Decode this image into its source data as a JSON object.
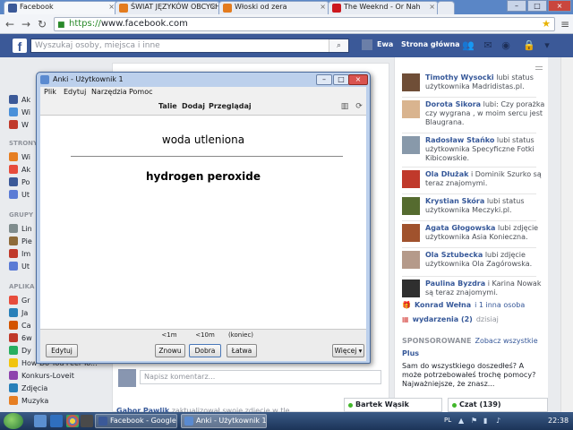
{
  "browser": {
    "tabs": [
      {
        "title": "Facebook",
        "color": "#3b5998"
      },
      {
        "title": "ŚWIAT JĘZYKÓW OBCYCH",
        "color": "#e37b1e"
      },
      {
        "title": "Włoski od zera",
        "color": "#e37b1e"
      },
      {
        "title": "The Weeknd - Or Nah",
        "color": "#cc181e"
      }
    ],
    "url_scheme": "https://",
    "url_host": "www.facebook.com"
  },
  "facebook": {
    "search_placeholder": "Wyszukaj osoby, miejsca i inne",
    "user_name": "Ewa",
    "home_link": "Strona główna",
    "left": {
      "head_pages": "STRONY",
      "head_groups": "GRUPY",
      "head_apps": "APLIKA",
      "items": [
        {
          "label": "Ak",
          "color": "#3b5998"
        },
        {
          "label": "Wi",
          "color": "#4a90d9"
        },
        {
          "label": "W",
          "color": "#c0392b"
        },
        {
          "label": "Wi",
          "color": "#e67e22"
        },
        {
          "label": "Ak",
          "color": "#e74c3c"
        },
        {
          "label": "Po",
          "color": "#3b5998"
        },
        {
          "label": "Ut",
          "color": "#5b7bd5"
        },
        {
          "label": "Lin",
          "color": "#7f8c8d"
        },
        {
          "label": "Pie",
          "color": "#8e6b3a"
        },
        {
          "label": "Im",
          "color": "#c0392b"
        },
        {
          "label": "Ut",
          "color": "#5b7bd5"
        },
        {
          "label": "Gr",
          "color": "#e74c3c"
        },
        {
          "label": "Ja",
          "color": "#2980b9"
        },
        {
          "label": "Ca",
          "color": "#d35400"
        },
        {
          "label": "6w",
          "color": "#c0392b"
        },
        {
          "label": "Dy",
          "color": "#27ae60"
        },
        {
          "label": "How Do You Feel To...",
          "color": "#f1c40f"
        },
        {
          "label": "Konkurs-Loveit",
          "color": "#8e44ad"
        },
        {
          "label": "Zdjęcia",
          "color": "#2980b9"
        },
        {
          "label": "Muzyka",
          "color": "#e67e22"
        }
      ]
    },
    "comment_placeholder": "Napisz komentarz...",
    "feed_bottom_who": "Gabor Pawlik",
    "feed_bottom_text": "zaktualizował swoje zdjęcie w tle",
    "ticker": [
      {
        "name": "Timothy Wysocki",
        "text": "lubi status użytkownika Madridistas.pl.",
        "color": "#6f4e37"
      },
      {
        "name": "Dorota Sikora",
        "text": "lubi: Czy porażka czy wygrana , w moim sercu jest Blaugrana.",
        "color": "#d9b48f"
      },
      {
        "name": "Radosław Stańko",
        "text": "lubi status użytkownika Specyficzne Fotki Kibicowskie.",
        "color": "#8899aa"
      },
      {
        "name": "Ola Dłużak",
        "text": "i Dominik Szurko są teraz znajomymi.",
        "color": "#c0392b"
      },
      {
        "name": "Krystian Skóra",
        "text": "lubi status użytkownika Meczyki.pl.",
        "color": "#556b2f"
      },
      {
        "name": "Agata Głogowska",
        "text": "lubi zdjęcie użytkownika Asia Konieczna.",
        "color": "#a0522d"
      },
      {
        "name": "Ola Sztubecka",
        "text": "lubi zdjęcie użytkownika Ola Zagórowska.",
        "color": "#b59a8a"
      },
      {
        "name": "Paulina Byzdra",
        "text": "i Karina Nowak są teraz znajomymi.",
        "color": "#2f2f2f"
      }
    ],
    "birthday_name": "Konrad Wełna",
    "birthday_more": "i 1 inna osoba",
    "events_label": "wydarzenia (2)",
    "events_when": "dzisiaj",
    "sponsored_label": "SPONSOROWANE",
    "create_ad": "Zobacz wszystkie",
    "ad_title": "Plus",
    "ad_text": "Sam do wszystkiego doszedłeś? A może potrzebowałeś trochę pomocy? Najważniejsze, że znasz...",
    "chat_contact": "Bartek Wąsik",
    "chat_label": "Czat (139)"
  },
  "anki": {
    "title": "Anki - Użytkownik 1",
    "menu": [
      "Plik",
      "Edytuj",
      "Narzędzia",
      "Pomoc"
    ],
    "toolbar": [
      "Talie",
      "Dodaj",
      "Przeglądaj"
    ],
    "card_front": "woda utleniona",
    "card_back": "hydrogen peroxide",
    "edit_button": "Edytuj",
    "more_button": "Więcej ▾",
    "ease": [
      {
        "time": "<1m",
        "label": "Znowu"
      },
      {
        "time": "<10m",
        "label": "Dobra"
      },
      {
        "time": "(koniec)",
        "label": "Łatwa"
      }
    ]
  },
  "taskbar": {
    "tasks": [
      "Facebook - Google ...",
      "Anki - Użytkownik 1"
    ],
    "lang": "PL",
    "clock": "22:38"
  }
}
